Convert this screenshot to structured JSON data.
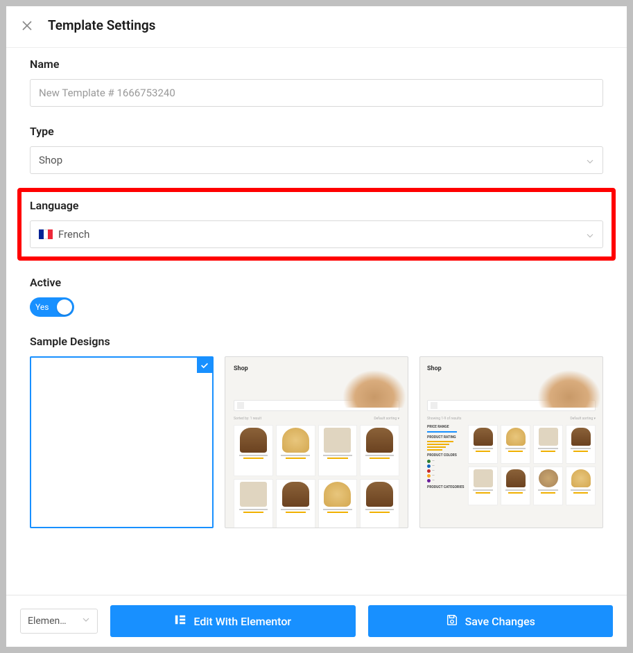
{
  "header": {
    "title": "Template Settings"
  },
  "fields": {
    "name": {
      "label": "Name",
      "value": "New Template # 1666753240"
    },
    "type": {
      "label": "Type",
      "value": "Shop"
    },
    "language": {
      "label": "Language",
      "value": "French",
      "flag": "fr"
    },
    "active": {
      "label": "Active",
      "value": "Yes",
      "on": true
    },
    "sample_designs": {
      "label": "Sample Designs",
      "selected_index": 0,
      "items": [
        {
          "id": "design-blank",
          "mock_label": ""
        },
        {
          "id": "design-shop-grid",
          "mock_label": "Shop"
        },
        {
          "id": "design-shop-sidebar",
          "mock_label": "Shop"
        }
      ]
    }
  },
  "footer": {
    "editor_select": "Elemen…",
    "edit_button": "Edit With Elementor",
    "save_button": "Save Changes"
  },
  "colors": {
    "primary": "#1890ff",
    "highlight": "#ff0000"
  }
}
